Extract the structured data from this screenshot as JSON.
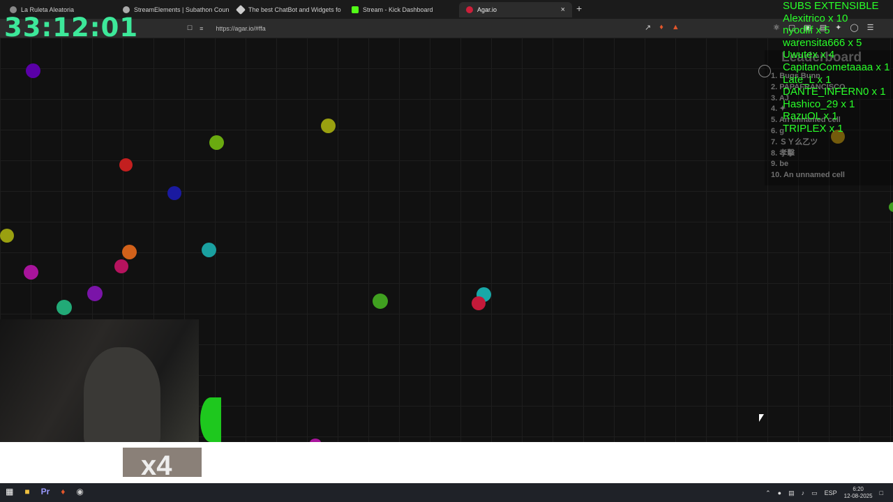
{
  "browser": {
    "tabs": [
      {
        "label": "La Ruleta Aleatoria",
        "color": "#888888"
      },
      {
        "label": "StreamElements | Subathon Countdo",
        "color": "#aaaaaa"
      },
      {
        "label": "The best ChatBot and Widgets fo",
        "color": "#cccccc"
      },
      {
        "label": "Stream - Kick Dashboard",
        "color": "#53fc18"
      },
      {
        "label": "Agar.io",
        "color": "#cc1f3a",
        "active": true
      }
    ],
    "new_tab": "+",
    "close": "×",
    "url": "https://agar.io/#ffa"
  },
  "overlay": {
    "timer": "33:12:01",
    "subs_title": "SUBS EXTENSIBLE",
    "subs": [
      "Alexitrico x 10",
      "nyodlif x 5",
      "warensita666 x 5",
      "Uwutex x 4",
      "CapitanCometaaaa x 1",
      "Late_L x 1",
      "DANTE_INFERN0 x 1",
      "Hashico_29 x 1",
      "RazuOL x 1",
      "TRIPLEX x 1"
    ]
  },
  "leaderboard": {
    "title": "Leaderboard",
    "entries": [
      "1. Bugs Bunn",
      "2. PAPAFRANCISCO",
      "3. AJ",
      "4. ✦",
      "5. An unnamed cell",
      "6. g",
      "7. ＳＹ么乙ツ",
      "8. 孝擊",
      "9. be",
      "10. An unnamed cell"
    ]
  },
  "badge": "x4",
  "taskbar": {
    "language": "ESP",
    "time": "6:20",
    "date": "12-08-2025"
  },
  "pellet_colors": [
    "#5a00a8",
    "#6aaa10",
    "#5aa012",
    "#c31f1f",
    "#1a1aa0",
    "#9aa010",
    "#d2611a",
    "#1aa0a0",
    "#b5135e",
    "#a8149c",
    "#22aa77",
    "#18a8a8",
    "#40a020",
    "#c41a3a"
  ]
}
